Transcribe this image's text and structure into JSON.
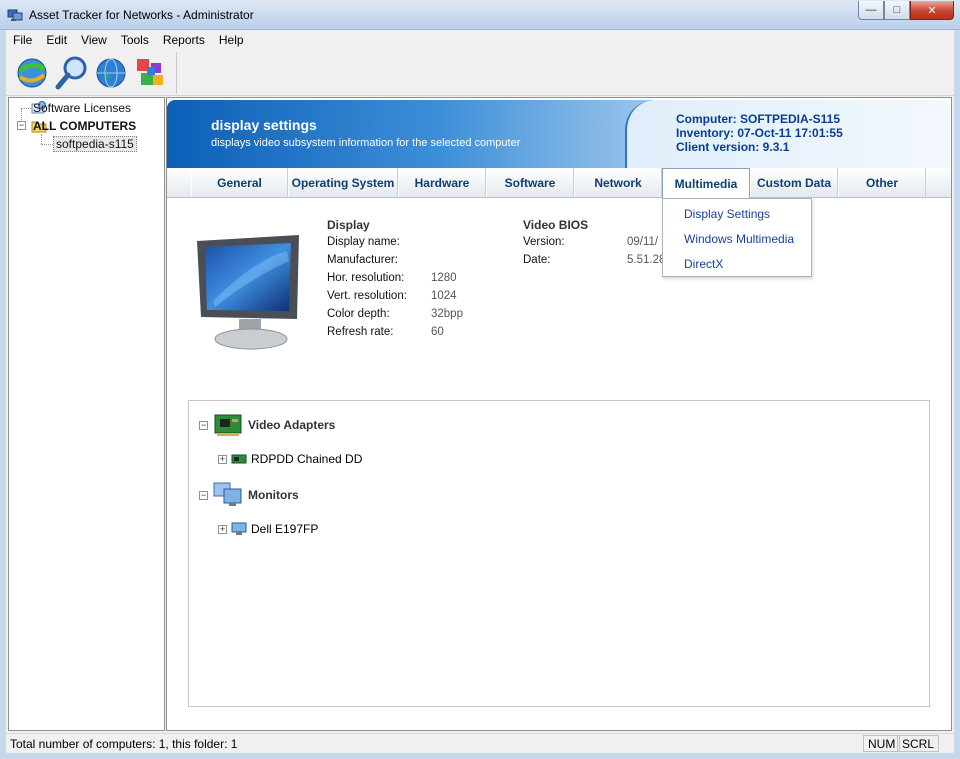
{
  "window": {
    "title": "Asset Tracker for Networks - Administrator"
  },
  "menu": [
    "File",
    "Edit",
    "View",
    "Tools",
    "Reports",
    "Help"
  ],
  "toolbar": {
    "icons": [
      "refresh-globe-icon",
      "search-icon",
      "globe-icon",
      "network-blocks-icon"
    ]
  },
  "tree": {
    "items": [
      {
        "label": "Software Licenses",
        "icon": "licenses-icon"
      },
      {
        "label": "ALL COMPUTERS",
        "icon": "folder-icon"
      },
      {
        "label": "softpedia-s115",
        "icon": "computer-icon"
      }
    ]
  },
  "banner": {
    "title": "display settings",
    "subtitle": "displays video subsystem information for the selected computer",
    "computer": "Computer: SOFTPEDIA-S115",
    "inventory": "Inventory: 07-Oct-11 17:01:55",
    "client_version": "Client version: 9.3.1"
  },
  "tabs": [
    "General",
    "Operating System",
    "Hardware",
    "Software",
    "Network",
    "Multimedia",
    "Custom Data",
    "Other"
  ],
  "dropdown": [
    "Display Settings",
    "Windows Multimedia",
    "DirectX"
  ],
  "display": {
    "heading": "Display",
    "rows": [
      {
        "label": "Display name:",
        "value": ""
      },
      {
        "label": "Manufacturer:",
        "value": ""
      },
      {
        "label": "Hor. resolution:",
        "value": "1280"
      },
      {
        "label": "Vert. resolution:",
        "value": "1024"
      },
      {
        "label": "Color depth:",
        "value": "32bpp"
      },
      {
        "label": "Refresh rate:",
        "value": "60"
      }
    ]
  },
  "bios": {
    "heading": "Video BIOS",
    "rows": [
      {
        "label": "Version:",
        "value": "09/11/"
      },
      {
        "label": "Date:",
        "value": "5.51.28"
      }
    ]
  },
  "devices": {
    "groups": [
      {
        "label": "Video Adapters",
        "child": "RDPDD Chained DD"
      },
      {
        "label": "Monitors",
        "child": "Dell E197FP"
      }
    ]
  },
  "status": {
    "text": "Total number of computers: 1, this folder: 1",
    "num": "NUM",
    "scrl": "SCRL"
  },
  "colors": {
    "banner_blue": "#0b5fb6",
    "tab_text": "#0e3e74",
    "link_blue": "#1a3f9c"
  }
}
